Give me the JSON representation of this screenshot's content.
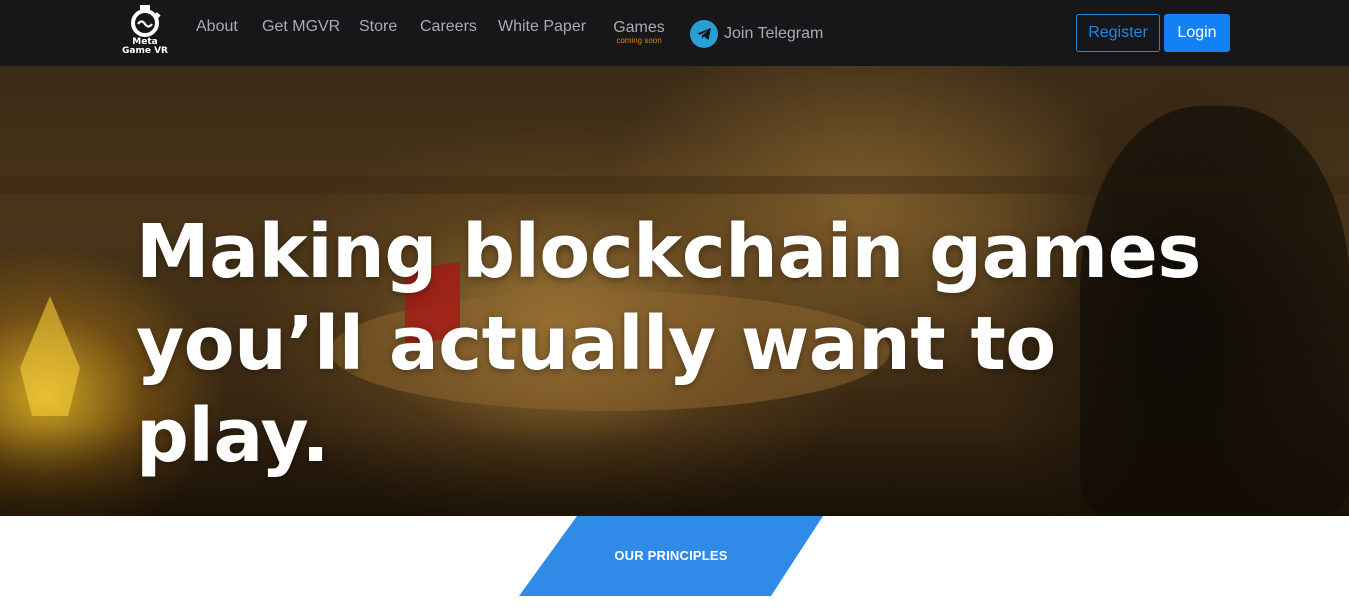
{
  "brand": {
    "logo_line1": "Meta",
    "logo_line2": "Game VR"
  },
  "nav": {
    "links": [
      "About",
      "Get MGVR",
      "Store",
      "Careers",
      "White Paper"
    ],
    "games_label": "Games",
    "games_sublabel": "coming soon",
    "telegram_label": "Join Telegram"
  },
  "auth": {
    "register_label": "Register",
    "login_label": "Login"
  },
  "hero": {
    "headline_line1": "Making blockchain games",
    "headline_line2": "you’ll actually want to play."
  },
  "principles": {
    "label": "OUR PRINCIPLES"
  },
  "colors": {
    "navbar_bg": "#17171a",
    "nav_text": "#a9abb0",
    "accent_blue": "#1181f5",
    "games_badge": "#d9850f",
    "telegram_blue": "#2a9fd6",
    "principles_bg": "#2f8ae8"
  },
  "icons": [
    "logo-mark-icon",
    "telegram-icon"
  ]
}
